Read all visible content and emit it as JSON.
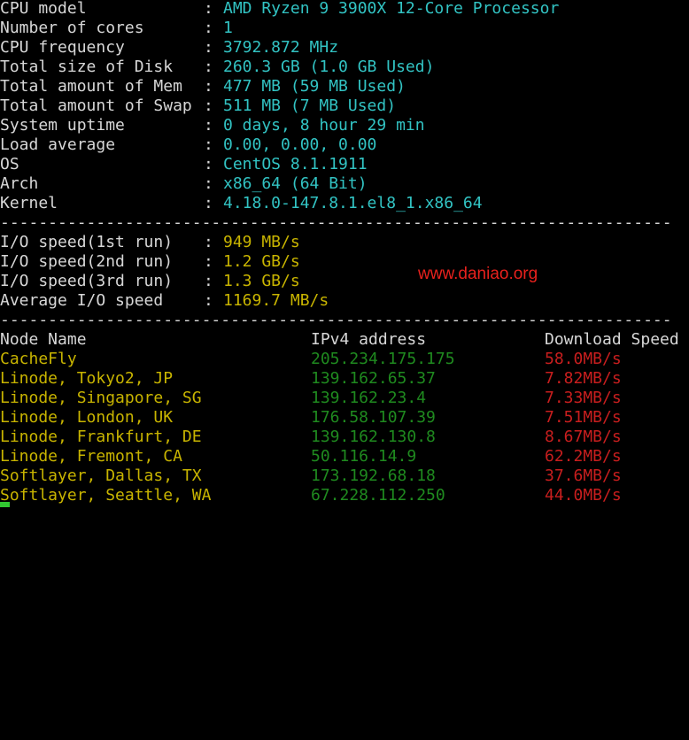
{
  "system_info": [
    {
      "label": "CPU model",
      "value": "AMD Ryzen 9 3900X 12-Core Processor"
    },
    {
      "label": "Number of cores",
      "value": "1"
    },
    {
      "label": "CPU frequency",
      "value": "3792.872 MHz"
    },
    {
      "label": "Total size of Disk",
      "value": "260.3 GB (1.0 GB Used)"
    },
    {
      "label": "Total amount of Mem",
      "value": "477 MB (59 MB Used)"
    },
    {
      "label": "Total amount of Swap",
      "value": "511 MB (7 MB Used)"
    },
    {
      "label": "System uptime",
      "value": "0 days, 8 hour 29 min"
    },
    {
      "label": "Load average",
      "value": "0.00, 0.00, 0.00"
    },
    {
      "label": "OS",
      "value": "CentOS 8.1.1911"
    },
    {
      "label": "Arch",
      "value": "x86_64 (64 Bit)"
    },
    {
      "label": "Kernel",
      "value": "4.18.0-147.8.1.el8_1.x86_64"
    }
  ],
  "colon": ":",
  "separator": "----------------------------------------------------------------------",
  "io_tests": [
    {
      "label": "I/O speed(1st run)",
      "value": "949 MB/s"
    },
    {
      "label": "I/O speed(2nd run)",
      "value": "1.2 GB/s"
    },
    {
      "label": "I/O speed(3rd run)",
      "value": "1.3 GB/s"
    },
    {
      "label": "Average I/O speed",
      "value": "1169.7 MB/s"
    }
  ],
  "speed_table": {
    "headers": {
      "node": "Node Name",
      "ip": "IPv4 address",
      "speed": "Download Speed"
    },
    "rows": [
      {
        "node": "CacheFly",
        "ip": "205.234.175.175",
        "speed": "58.0MB/s"
      },
      {
        "node": "Linode, Tokyo2, JP",
        "ip": "139.162.65.37",
        "speed": "7.82MB/s"
      },
      {
        "node": "Linode, Singapore, SG",
        "ip": "139.162.23.4",
        "speed": "7.33MB/s"
      },
      {
        "node": "Linode, London, UK",
        "ip": "176.58.107.39",
        "speed": "7.51MB/s"
      },
      {
        "node": "Linode, Frankfurt, DE",
        "ip": "139.162.130.8",
        "speed": "8.67MB/s"
      },
      {
        "node": "Linode, Fremont, CA",
        "ip": "50.116.14.9",
        "speed": "62.2MB/s"
      },
      {
        "node": "Softlayer, Dallas, TX",
        "ip": "173.192.68.18",
        "speed": "37.6MB/s"
      },
      {
        "node": "Softlayer, Seattle, WA",
        "ip": "67.228.112.250",
        "speed": "44.0MB/s"
      }
    ]
  },
  "watermark": "www.daniao.org",
  "colors": {
    "background": "#000000",
    "label_text": "#d7d7d7",
    "system_value": "#32c3c3",
    "io_value": "#c8b400",
    "node_name": "#c8b400",
    "ip_address": "#1f8a1f",
    "download_speed": "#c81e1e",
    "watermark": "#e8211d",
    "cursor": "#32c832"
  }
}
